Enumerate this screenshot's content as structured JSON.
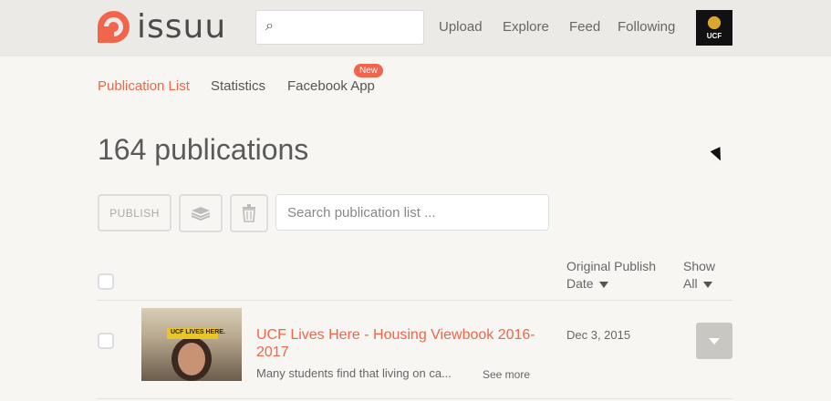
{
  "header": {
    "logo_text": "issuu",
    "search_placeholder": "",
    "nav": [
      "Upload",
      "Explore",
      "Feed",
      "Following"
    ],
    "avatar_label": "UCF"
  },
  "tabs": {
    "items": [
      "Publication List",
      "Statistics",
      "Facebook App"
    ],
    "active": "Publication List",
    "new_badge": "New"
  },
  "main": {
    "heading": "164 publications",
    "toolbar": {
      "publish_label": "PUBLISH",
      "search_placeholder": "Search publication list ..."
    },
    "columns": {
      "date": "Original Publish Date",
      "show": "Show All"
    },
    "rows": [
      {
        "title": "UCF Lives Here - Housing Viewbook 2016-2017",
        "description": "Many students find that living on ca...",
        "see_more": "See more",
        "date": "Dec 3, 2015",
        "thumb_banner": "UCF LIVES HERE."
      }
    ]
  },
  "colors": {
    "accent": "#f0654c",
    "topbar": "#ebeae6",
    "page": "#f7f6f3"
  }
}
